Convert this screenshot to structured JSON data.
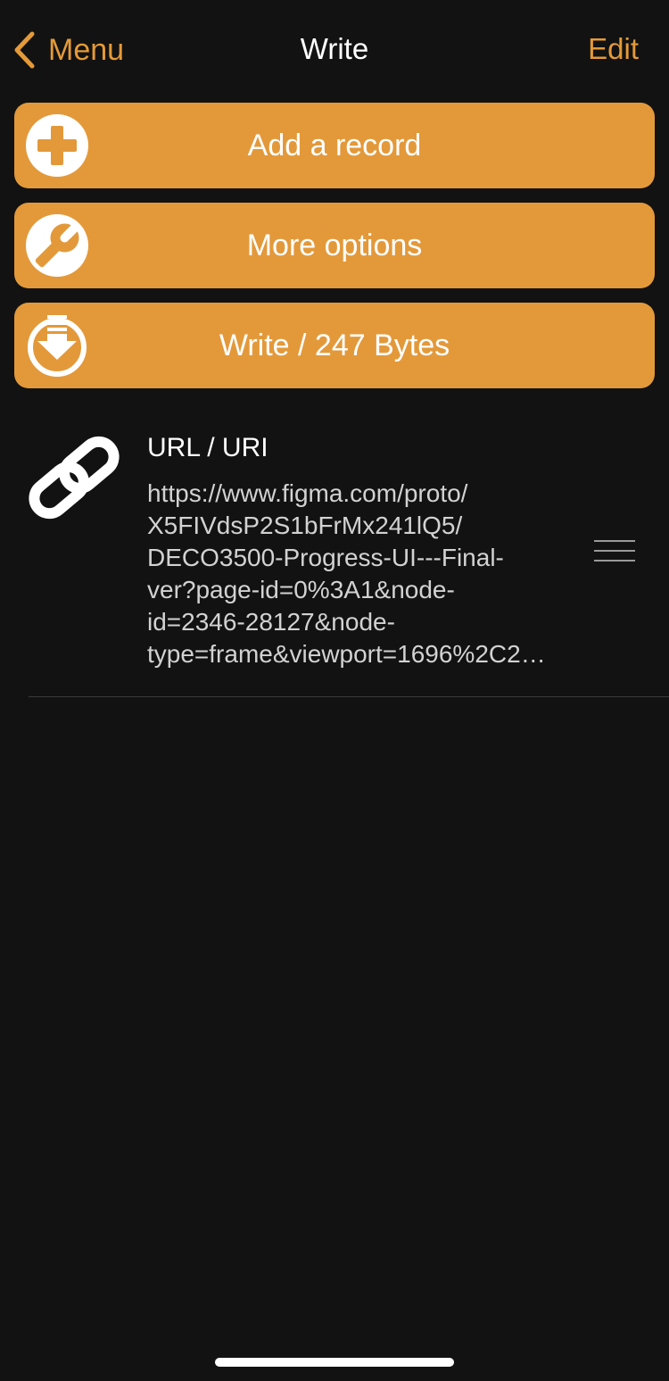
{
  "nav": {
    "back_label": "Menu",
    "title": "Write",
    "edit_label": "Edit"
  },
  "actions": {
    "add_record": "Add a record",
    "more_options": "More options",
    "write": "Write / 247 Bytes"
  },
  "records": [
    {
      "type": "URL / URI",
      "value": "https://www.figma.com/proto/\nX5FIVdsP2S1bFrMx241lQ5/\nDECO3500-Progress-UI---Final-\nver?page-id=0%3A1&node-\nid=2346-28127&node-\ntype=frame&viewport=1696%2C2…",
      "icon": "link-icon"
    }
  ],
  "colors": {
    "accent": "#E3993A",
    "background": "#121212"
  }
}
